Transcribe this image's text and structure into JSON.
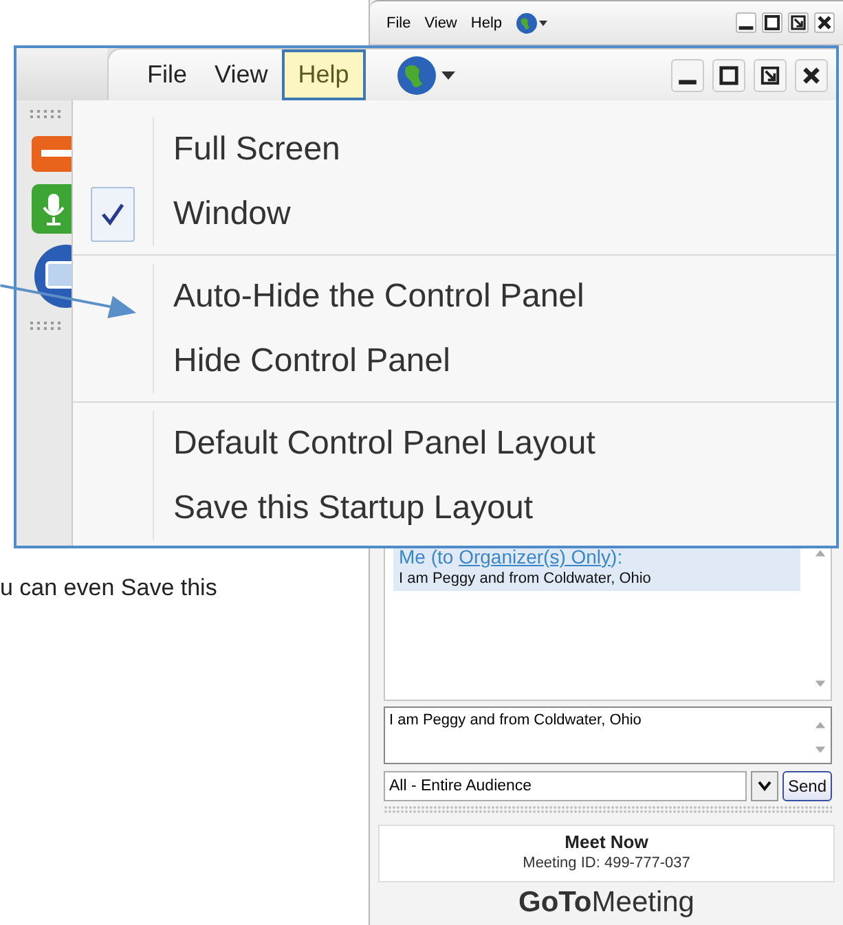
{
  "panel": {
    "menus": [
      {
        "label": "File"
      },
      {
        "label": "View"
      },
      {
        "label": "Help"
      }
    ],
    "chat": {
      "messages": [
        {
          "prefix": "Me (to ",
          "recipient": "Organizer(s) Only",
          "suffix": "):",
          "text": "I am Peggy and from Coldwater, Ohio",
          "selected": true
        }
      ]
    },
    "input": {
      "value": "I am Peggy and from Coldwater, Ohio"
    },
    "recipient_select": "All - Entire Audience",
    "send_button": "Send",
    "meet_now": {
      "title": "Meet Now",
      "meeting_id": "Meeting ID: 499-777-037"
    },
    "logo": "**GoTo**Meeting"
  },
  "caption": "u can even Save this",
  "callout": {
    "menus": [
      {
        "label": "File",
        "selected": false
      },
      {
        "label": "View",
        "selected": false
      },
      {
        "label": "Help",
        "selected": true
      }
    ],
    "menu_sections": [
      {
        "items": [
          {
            "label": "Full Screen",
            "checked": false
          },
          {
            "label": "Window",
            "checked": true
          }
        ]
      },
      {
        "items": [
          {
            "label": "Auto-Hide the Control Panel",
            "checked": false
          },
          {
            "label": "Hide Control Panel",
            "checked": false
          }
        ]
      },
      {
        "items": [
          {
            "label": "Default Control Panel Layout",
            "checked": false
          },
          {
            "label": "Save this Startup Layout",
            "checked": false
          }
        ]
      }
    ]
  }
}
